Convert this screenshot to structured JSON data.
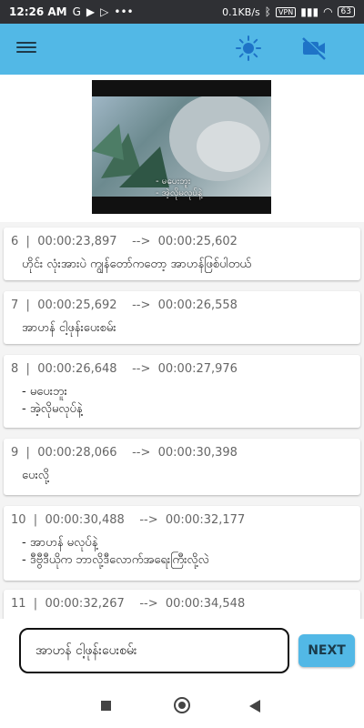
{
  "status_bar": {
    "time": "12:26 AM",
    "speed": "0.1KB/s",
    "vpn": "VPN",
    "battery": "63"
  },
  "app_bar": {
    "menu_icon": "menu-icon",
    "brightness_icon": "sun-icon",
    "video_off_icon": "video-off-icon",
    "accent": "#52b8e6"
  },
  "video": {
    "subtitle_lines": [
      "- မပေးဘူး",
      "- အဲ့လိုမလုပ်နဲ့"
    ]
  },
  "subtitles": [
    {
      "index": "6",
      "start": "00:00:23,897",
      "end": "00:00:25,602",
      "lines": [
        "ဟိုင်း လုံးအားပဲ ကျွန်တော်ကတော့ အာဟန်ဖြစ်ပါတယ်"
      ]
    },
    {
      "index": "7",
      "start": "00:00:25,692",
      "end": "00:00:26,558",
      "lines": [
        "အာဟန် ငါ့ဖုန်းပေးစမ်း"
      ]
    },
    {
      "index": "8",
      "start": "00:00:26,648",
      "end": "00:00:27,976",
      "lines": [
        "- မပေးဘူး",
        "- အဲ့လိုမလုပ်နဲ့"
      ]
    },
    {
      "index": "9",
      "start": "00:00:28,066",
      "end": "00:00:30,398",
      "lines": [
        "ပေးလို့"
      ]
    },
    {
      "index": "10",
      "start": "00:00:30,488",
      "end": "00:00:32,177",
      "lines": [
        "- အာဟန် မလုပ်နဲ့",
        "- ဒီဗွီဒီယိုက ဘာလို့ဒီလောက်အရေးကြီးလို့လဲ"
      ]
    },
    {
      "index": "11",
      "start": "00:00:32,267",
      "end": "00:00:34,548",
      "lines": []
    }
  ],
  "editor": {
    "value": "အာဟန် ငါ့ဖုန်းပေးစမ်း",
    "next_label": "NEXT"
  },
  "nav": {
    "recents_icon": "square-icon",
    "home_icon": "circle-icon",
    "back_icon": "triangle-back-icon"
  }
}
